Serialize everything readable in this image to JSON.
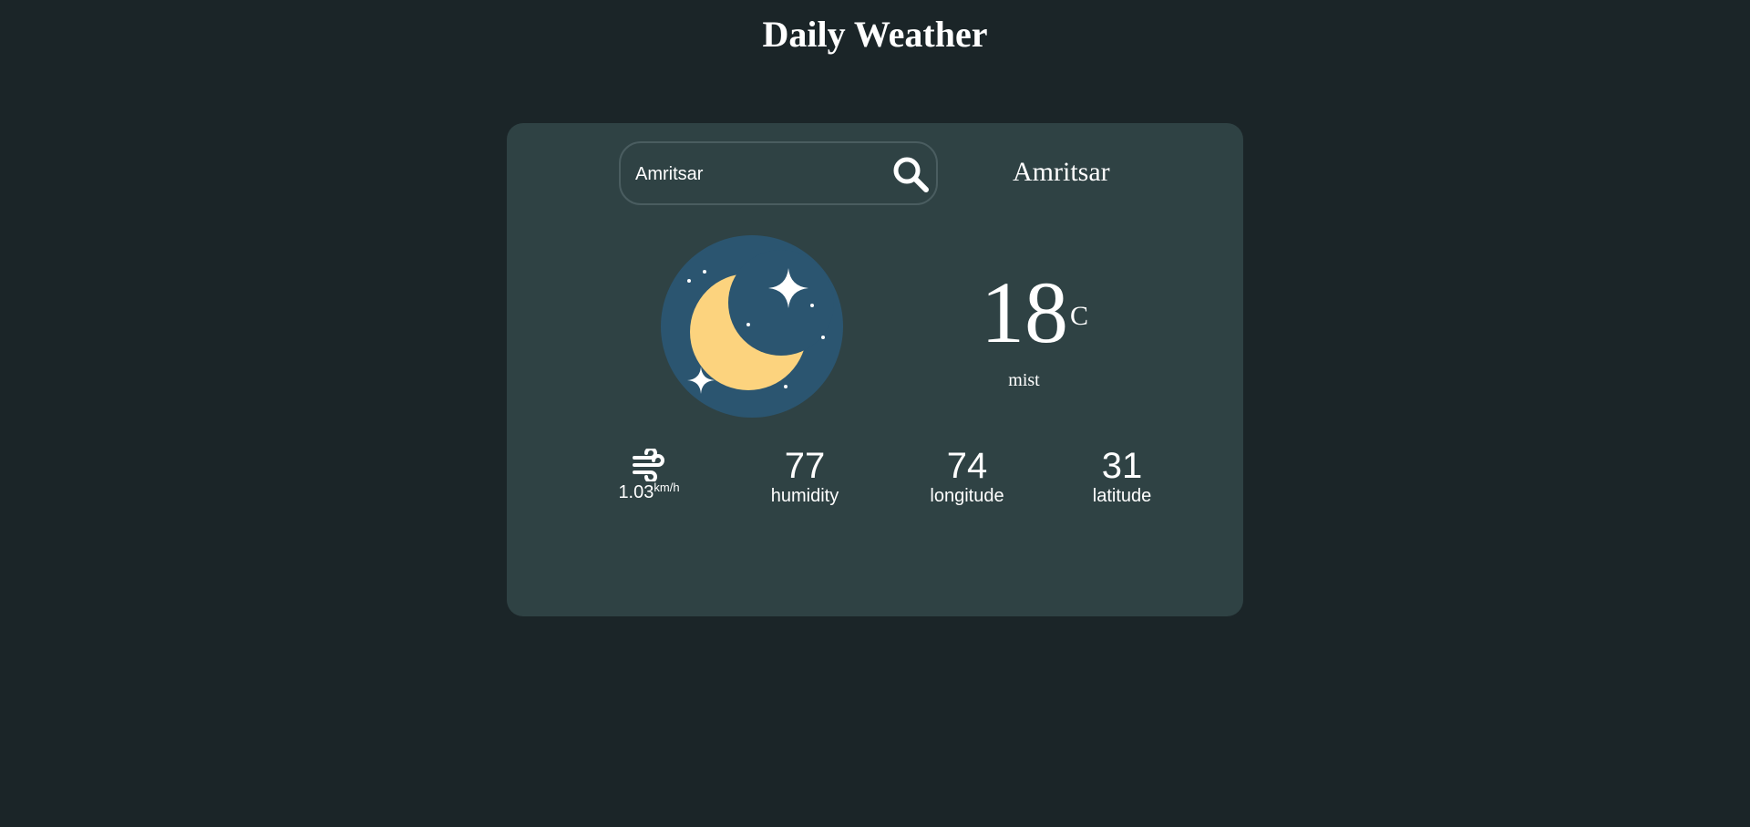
{
  "header": {
    "title": "Daily Weather"
  },
  "search": {
    "value": "Amritsar",
    "icon": "search-icon"
  },
  "location": {
    "city": "Amritsar"
  },
  "current": {
    "icon": "crescent-moon-night-icon",
    "temperature": "18",
    "unit": "C",
    "condition": "mist"
  },
  "wind": {
    "icon": "wind-icon",
    "value": "1.03",
    "unit": "km/h"
  },
  "stats": {
    "humidity": {
      "value": "77",
      "label": "humidity"
    },
    "longitude": {
      "value": "74",
      "label": "longitude"
    },
    "latitude": {
      "value": "31",
      "label": "latitude"
    }
  },
  "colors": {
    "page_background": "#1b2528",
    "card_background": "#2f4244",
    "icon_circle": "#2b5570",
    "moon": "#fcd37e",
    "text": "#ffffff"
  }
}
